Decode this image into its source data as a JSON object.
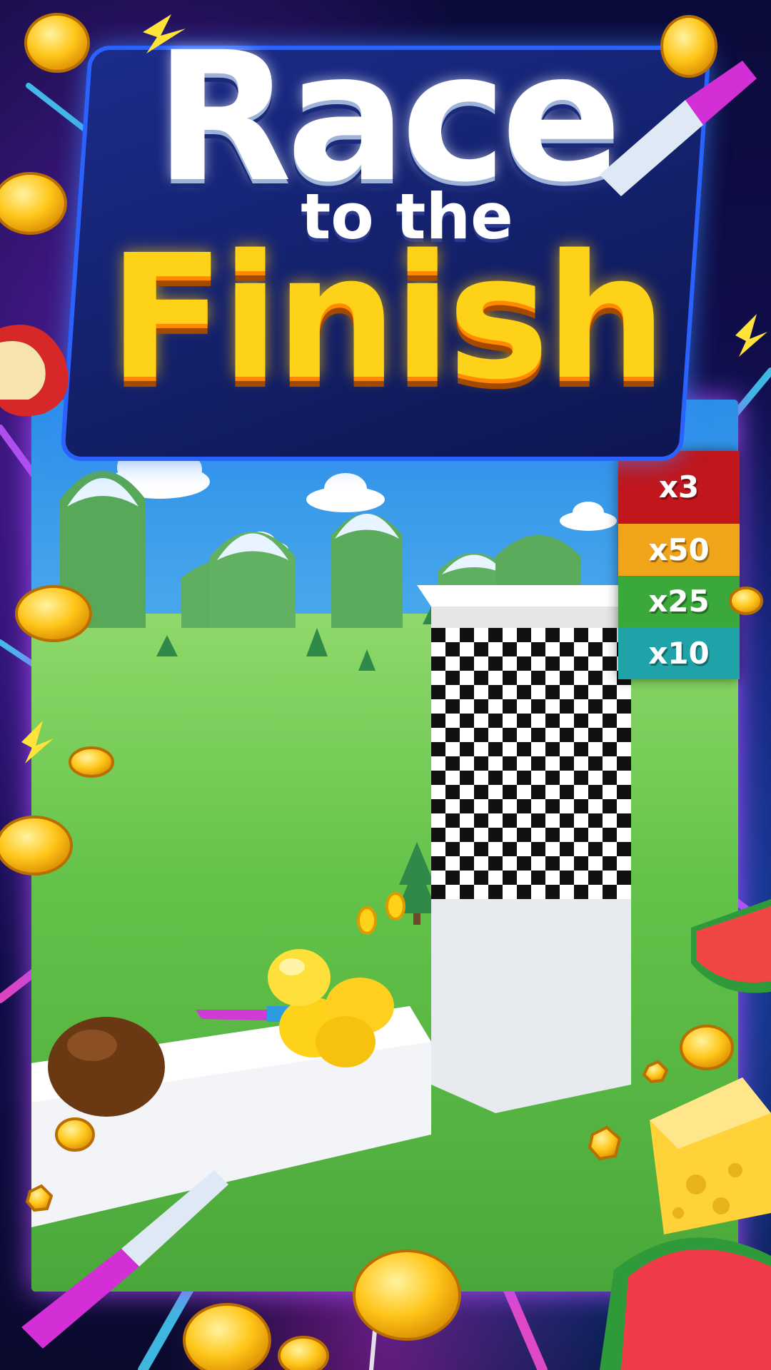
{
  "title": {
    "line1": "Race",
    "line2": "to the",
    "line3": "Finish"
  },
  "multipliers": [
    {
      "label": "x3",
      "color": "#c0161c"
    },
    {
      "label": "x50",
      "color": "#f0a41a"
    },
    {
      "label": "x25",
      "color": "#3aa83a"
    },
    {
      "label": "x10",
      "color": "#1fa3a8"
    }
  ],
  "icons": [
    "coin-icon",
    "knife-icon",
    "watermelon-icon",
    "cheese-icon",
    "apple-icon",
    "coconut-icon",
    "lightning-icon",
    "checkered-finish-tower",
    "lemon-stack",
    "tree-icon",
    "cloud-icon"
  ]
}
